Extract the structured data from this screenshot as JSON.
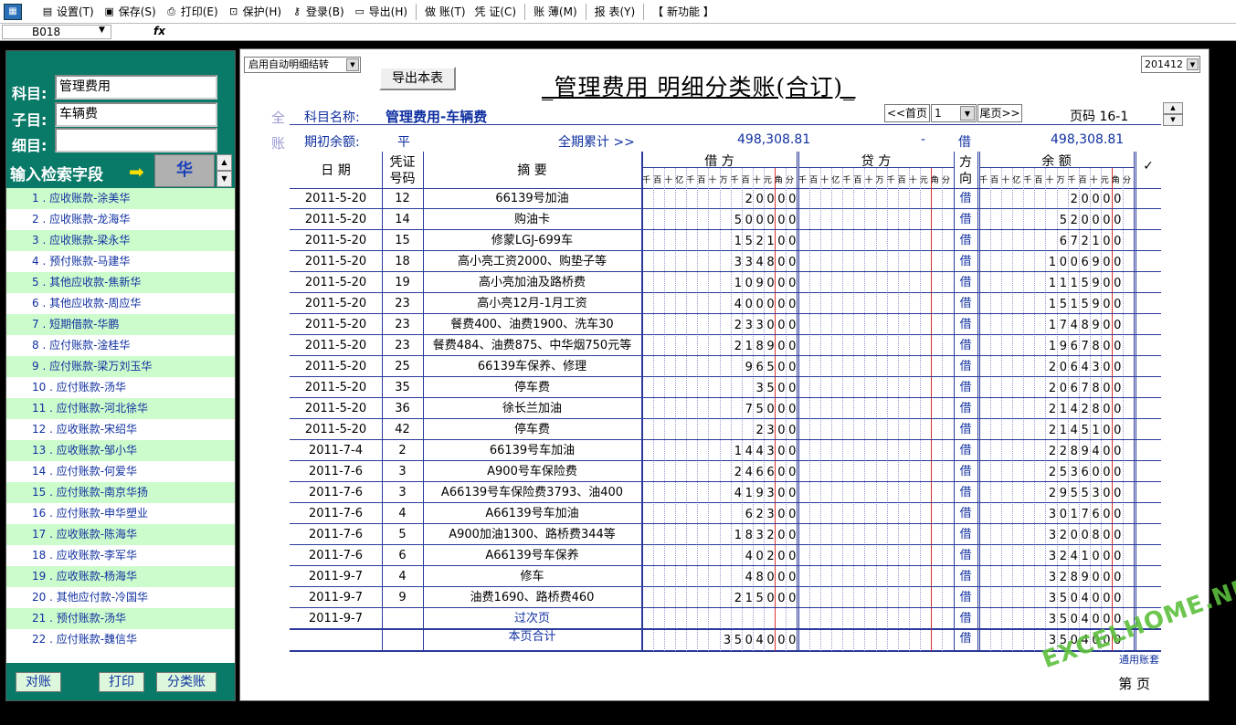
{
  "toolbar": {
    "items": [
      {
        "icon": "settings-icon",
        "label": "设置(T)"
      },
      {
        "icon": "save-icon",
        "label": "保存(S)"
      },
      {
        "icon": "print-icon",
        "label": "打印(E)"
      },
      {
        "icon": "lock-icon",
        "label": "保护(H)"
      },
      {
        "icon": "key-icon",
        "label": "登录(B)"
      },
      {
        "icon": "folder-icon",
        "label": "导出(H)"
      },
      {
        "icon": "",
        "label": "做  账(T)"
      },
      {
        "icon": "",
        "label": "凭  证(C)"
      },
      {
        "icon": "",
        "label": "账  薄(M)"
      },
      {
        "icon": "",
        "label": "报  表(Y)"
      },
      {
        "icon": "",
        "label": "【 新功能 】"
      }
    ]
  },
  "formula_bar": {
    "name_box": "B018",
    "fx": "fx"
  },
  "left": {
    "subject_label": "科目:",
    "subject_value": "管理费用",
    "sub_label": "子目:",
    "sub_value": "车辆费",
    "detail_label": "细目:",
    "detail_value": "",
    "search_label": "输入检索字段",
    "search_value": "华",
    "list": [
      "1 . 应收账款-涂美华",
      "2 . 应收账款-龙海华",
      "3 . 应收账款-梁永华",
      "4 . 预付账款-马建华",
      "5 . 其他应收款-焦新华",
      "6 . 其他应收款-周应华",
      "7 . 短期借款-华鹏",
      "8 . 应付账款-淦桂华",
      "9 . 应付账款-梁万刘玉华",
      "10 . 应付账款-汤华",
      "11 . 应付账款-河北徐华",
      "12 . 应收账款-宋绍华",
      "13 . 应收账款-邹小华",
      "14 . 应付账款-何爱华",
      "15 . 应付账款-南京华扬",
      "16 . 应付账款-申华塑业",
      "17 . 应收账款-陈海华",
      "18 . 应收账款-李军华",
      "19 . 应收账款-杨海华",
      "20 . 其他应付款-冷国华",
      "21 . 预付账款-汤华",
      "22 . 应付账款-魏信华"
    ],
    "btn_reconcile": "对账",
    "btn_print": "打印",
    "btn_classify": "分类账"
  },
  "main": {
    "auto_detail": "启用自动明细结转",
    "export": "导出本表",
    "title": "_管理费用  明细分类账(合订)_",
    "period": "201412",
    "side_chars": [
      "全",
      "账"
    ],
    "subject_name_label": "科目名称:",
    "subject_name": "管理费用-车辆费",
    "first_page": "<<首页",
    "page_input": "1",
    "last_page": "尾页>>",
    "page_code": "页码 16-1",
    "opening_label": "期初余额:",
    "opening_dir": "平",
    "cumulative_label": "全期累计 >>",
    "cumulative_debit": "498,308.81",
    "cumulative_credit": "-",
    "cumulative_dir": "借",
    "cumulative_balance": "498,308.81",
    "headers": {
      "date": "日  期",
      "voucher1": "凭证",
      "voucher2": "号码",
      "summary": "摘    要",
      "debit": "借    方",
      "credit": "贷    方",
      "dir1": "方",
      "dir2": "向",
      "balance": "余    额",
      "check": "✓"
    },
    "digit_units": [
      "千",
      "百",
      "十",
      "亿",
      "千",
      "百",
      "十",
      "万",
      "千",
      "百",
      "十",
      "元",
      "角",
      "分"
    ],
    "rows": [
      {
        "date": "2011-5-20",
        "vno": "12",
        "summary": "66139号加油",
        "debit": "20000",
        "dir": "借",
        "balance": "20000"
      },
      {
        "date": "2011-5-20",
        "vno": "14",
        "summary": "购油卡",
        "debit": "500000",
        "dir": "借",
        "balance": "520000"
      },
      {
        "date": "2011-5-20",
        "vno": "15",
        "summary": "修蒙LGJ-699车",
        "debit": "152100",
        "dir": "借",
        "balance": "672100"
      },
      {
        "date": "2011-5-20",
        "vno": "18",
        "summary": "高小亮工资2000、购垫子等",
        "debit": "334800",
        "dir": "借",
        "balance": "1006900"
      },
      {
        "date": "2011-5-20",
        "vno": "19",
        "summary": "高小亮加油及路桥费",
        "debit": "109000",
        "dir": "借",
        "balance": "1115900"
      },
      {
        "date": "2011-5-20",
        "vno": "23",
        "summary": "高小亮12月-1月工资",
        "debit": "400000",
        "dir": "借",
        "balance": "1515900"
      },
      {
        "date": "2011-5-20",
        "vno": "23",
        "summary": "餐费400、油费1900、洗车30",
        "debit": "233000",
        "dir": "借",
        "balance": "1748900"
      },
      {
        "date": "2011-5-20",
        "vno": "23",
        "summary": "餐费484、油费875、中华烟750元等",
        "debit": "218900",
        "dir": "借",
        "balance": "1967800"
      },
      {
        "date": "2011-5-20",
        "vno": "25",
        "summary": "66139车保养、修理",
        "debit": "96500",
        "dir": "借",
        "balance": "2064300"
      },
      {
        "date": "2011-5-20",
        "vno": "35",
        "summary": "停车费",
        "debit": "3500",
        "dir": "借",
        "balance": "2067800"
      },
      {
        "date": "2011-5-20",
        "vno": "36",
        "summary": "徐长兰加油",
        "debit": "75000",
        "dir": "借",
        "balance": "2142800"
      },
      {
        "date": "2011-5-20",
        "vno": "42",
        "summary": "停车费",
        "debit": "2300",
        "dir": "借",
        "balance": "2145100"
      },
      {
        "date": "2011-7-4",
        "vno": "2",
        "summary": "66139号车加油",
        "debit": "144300",
        "dir": "借",
        "balance": "2289400"
      },
      {
        "date": "2011-7-6",
        "vno": "3",
        "summary": "A900号车保险费",
        "debit": "246600",
        "dir": "借",
        "balance": "2536000"
      },
      {
        "date": "2011-7-6",
        "vno": "3",
        "summary": "A66139号车保险费3793、油400",
        "debit": "419300",
        "dir": "借",
        "balance": "2955300"
      },
      {
        "date": "2011-7-6",
        "vno": "4",
        "summary": "A66139号车加油",
        "debit": "62300",
        "dir": "借",
        "balance": "3017600"
      },
      {
        "date": "2011-7-6",
        "vno": "5",
        "summary": "A900加油1300、路桥费344等",
        "debit": "183200",
        "dir": "借",
        "balance": "3200800"
      },
      {
        "date": "2011-7-6",
        "vno": "6",
        "summary": "A66139号车保养",
        "debit": "40200",
        "dir": "借",
        "balance": "3241000"
      },
      {
        "date": "2011-9-7",
        "vno": "4",
        "summary": "修车",
        "debit": "48000",
        "dir": "借",
        "balance": "3289000"
      },
      {
        "date": "2011-9-7",
        "vno": "9",
        "summary": "油费1690、路桥费460",
        "debit": "215000",
        "dir": "借",
        "balance": "3504000"
      },
      {
        "date": "2011-9-7",
        "vno": "",
        "summary": "过次页",
        "debit": "",
        "dir": "借",
        "balance": "3504000"
      }
    ],
    "page_total": {
      "summary": "本页合计",
      "debit": "3504000",
      "dir": "借",
      "balance": "3504000"
    },
    "company": "通用账套",
    "page_footer": "第  页"
  },
  "watermark": "EXCELHOME.NET",
  "colors": {
    "panel": "#0a7a68",
    "list_alt": "#ccfccc",
    "ink_blue": "#1030a0",
    "rule": "#2a3a9a",
    "red_rule": "#d83030"
  }
}
